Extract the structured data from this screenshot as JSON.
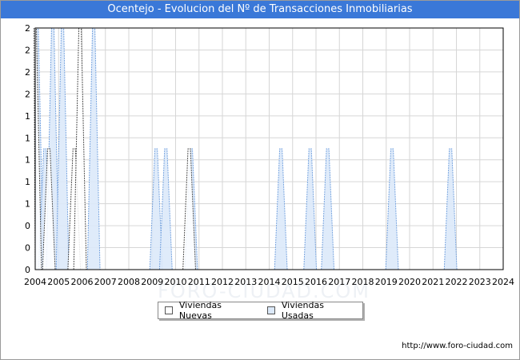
{
  "title": "Ocentejo - Evolucion del Nº de Transacciones Inmobiliarias",
  "source": "http://www.foro-ciudad.com",
  "watermark": "FORO-CIUDAD.COM",
  "colors": {
    "title_bg": "#3a78d8",
    "nuevas_fill": "#ffffff",
    "nuevas_stroke": "#555555",
    "usadas_fill": "#dce9f9",
    "usadas_stroke": "#7aa6e0"
  },
  "chart_data": {
    "type": "area",
    "title": "Ocentejo - Evolucion del Nº de Transacciones Inmobiliarias",
    "xlabel": "",
    "ylabel": "",
    "ylim": [
      0,
      2
    ],
    "x_ticks": [
      "2004",
      "2005",
      "2006",
      "2007",
      "2008",
      "2009",
      "2010",
      "2011",
      "2012",
      "2013",
      "2014",
      "2015",
      "2016",
      "2017",
      "2018",
      "2019",
      "2020",
      "2021",
      "2022",
      "2023",
      "2024"
    ],
    "y_ticks": [
      "0",
      "0",
      "0",
      "1",
      "1",
      "1",
      "1",
      "1",
      "2",
      "2",
      "2",
      "2"
    ],
    "grid": true,
    "legend_position": "bottom",
    "series": [
      {
        "name": "Viviendas Nuevas",
        "points": [
          {
            "x": "2004-01",
            "y": 2
          },
          {
            "x": "2004-08",
            "y": 1
          },
          {
            "x": "2005-09",
            "y": 1
          },
          {
            "x": "2005-12",
            "y": 2
          },
          {
            "x": "2010-08",
            "y": 1
          }
        ]
      },
      {
        "name": "Viviendas Usadas",
        "points": [
          {
            "x": "2004-02",
            "y": 2
          },
          {
            "x": "2004-06",
            "y": 1
          },
          {
            "x": "2004-10",
            "y": 2
          },
          {
            "x": "2005-03",
            "y": 2
          },
          {
            "x": "2006-07",
            "y": 2
          },
          {
            "x": "2009-03",
            "y": 1
          },
          {
            "x": "2009-08",
            "y": 1
          },
          {
            "x": "2010-09",
            "y": 1
          },
          {
            "x": "2014-07",
            "y": 1
          },
          {
            "x": "2015-10",
            "y": 1
          },
          {
            "x": "2016-07",
            "y": 1
          },
          {
            "x": "2019-04",
            "y": 1
          },
          {
            "x": "2021-10",
            "y": 1
          }
        ]
      }
    ]
  }
}
